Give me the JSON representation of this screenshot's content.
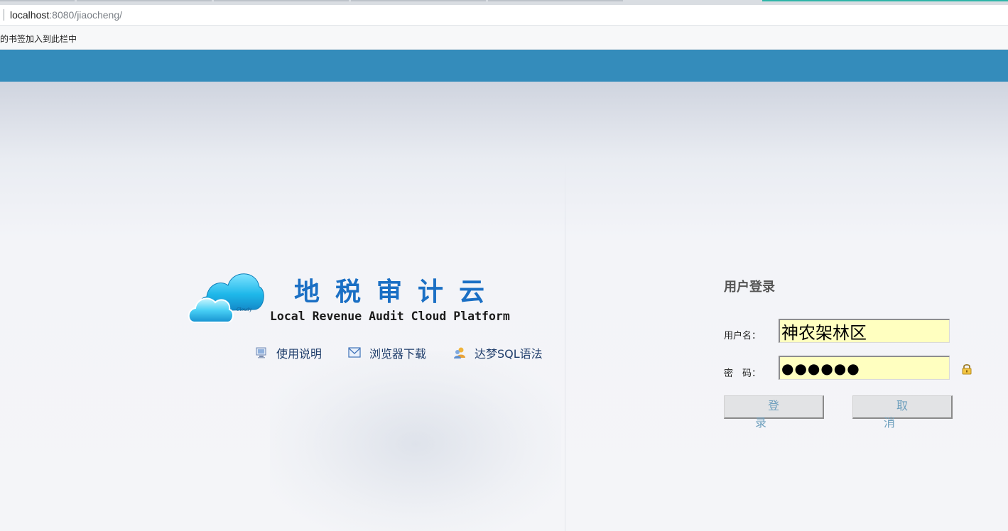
{
  "browser": {
    "address_host": "localhost",
    "address_rest": ":8080/jiaocheng/",
    "bookmarks_hint": "的书签加入到此栏中"
  },
  "logo": {
    "title": "地税审计云",
    "subtitle": "Local Revenue Audit Cloud Platform",
    "cloud_text": "Cloudy"
  },
  "links": [
    {
      "label": "使用说明",
      "icon": "monitor-icon"
    },
    {
      "label": "浏览器下载",
      "icon": "mail-download-icon"
    },
    {
      "label": "达梦SQL语法",
      "icon": "users-icon"
    }
  ],
  "login": {
    "title": "用户登录",
    "username_label": "用户名：",
    "username_value": "神农架林区",
    "password_label": "密　码：",
    "password_value": "●●●●●●",
    "login_button": "登录",
    "cancel_button": "取消"
  },
  "colors": {
    "header_bar": "#348cbb",
    "title_blue": "#1a6fc4",
    "field_bg": "#ffffc0",
    "button_text": "#6d9fbd"
  }
}
